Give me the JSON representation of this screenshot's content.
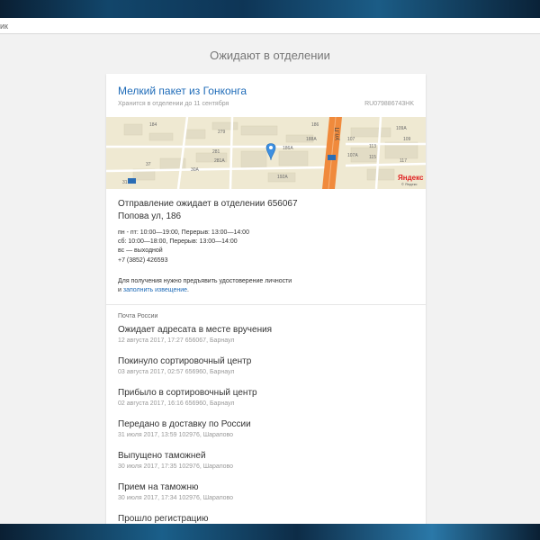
{
  "address_bar": {
    "text": "ик"
  },
  "page": {
    "title": "Ожидают в отделении"
  },
  "package": {
    "title": "Мелкий пакет из Гонконга",
    "stored_until": "Хранится в отделении до 11 сентября",
    "tracking_number": "RU079886743HK"
  },
  "map": {
    "street_label": "ул.П",
    "brand": "Яндекс",
    "copyright": "© Яндекс",
    "house_labels": [
      "186",
      "186A",
      "188A",
      "184",
      "107",
      "107A",
      "109",
      "109A",
      "113",
      "115",
      "117",
      "279",
      "281",
      "281A",
      "30A",
      "192A",
      "37",
      "31",
      "ул. П"
    ]
  },
  "office": {
    "line1": "Отправление ожидает в отделении 656067",
    "line2": "Попова ул, 186",
    "hours": [
      "пн - пт: 10:00—19:00, Перерыв: 13:00—14:00",
      "сб: 10:00—18:00, Перерыв: 13:00—14:00",
      "вс — выходной"
    ],
    "phone": "+7 (3852) 426593",
    "note_prefix": "Для получения нужно предъявить удостоверение личности",
    "note_mid": "и ",
    "note_link": "заполнить извещение",
    "note_suffix": "."
  },
  "history": {
    "carrier": "Почта России",
    "events": [
      {
        "title": "Ожидает адресата в месте вручения",
        "meta": "12 августа 2017, 17:27 656067, Барнаул"
      },
      {
        "title": "Покинуло сортировочный центр",
        "meta": "03 августа 2017, 02:57 656960, Барнаул"
      },
      {
        "title": "Прибыло в сортировочный центр",
        "meta": "02 августа 2017, 16:16 656960, Барнаул"
      },
      {
        "title": "Передано в доставку по России",
        "meta": "31 июля 2017, 13:59 102976, Шарапово"
      },
      {
        "title": "Выпущено таможней",
        "meta": "30 июля 2017, 17:35 102976, Шарапово"
      },
      {
        "title": "Прием на таможню",
        "meta": "30 июля 2017, 17:34 102976, Шарапово"
      },
      {
        "title": "Прошло регистрацию",
        "meta": ""
      }
    ]
  },
  "colors": {
    "link": "#1e6bb8",
    "road": "#f08a3c",
    "map_bg": "#efe9d2"
  }
}
